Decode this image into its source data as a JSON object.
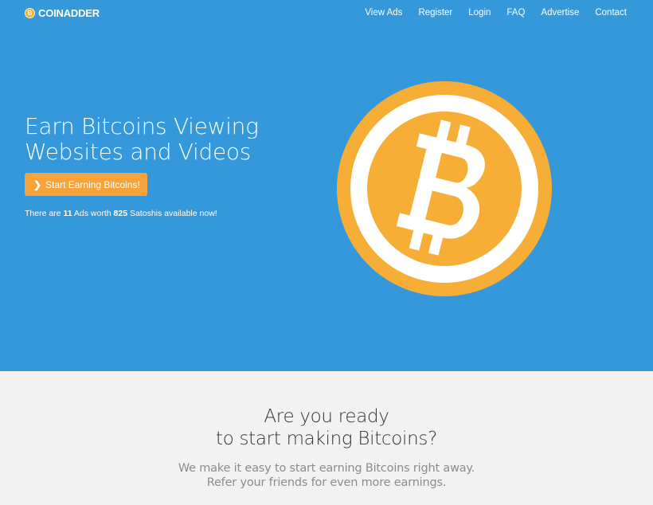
{
  "brand": {
    "coin_glyph": "B",
    "name": "COINADDER"
  },
  "nav": {
    "items": [
      {
        "label": "View Ads"
      },
      {
        "label": "Register"
      },
      {
        "label": "Login"
      },
      {
        "label": "FAQ"
      },
      {
        "label": "Advertise"
      },
      {
        "label": "Contact"
      }
    ]
  },
  "hero": {
    "headline_line1": "Earn Bitcoins Viewing",
    "headline_line2": "Websites and Videos",
    "cta_label": "Start Earning Bitcoins!",
    "cta_icon": "chevron-right-icon",
    "available_prefix": "There are",
    "ad_count": "11",
    "ads_worth": "Ads worth",
    "satoshi_amount": "825",
    "available_suffix": "Satoshis available now!"
  },
  "bitcoin_logo": {
    "icon": "bitcoin-icon"
  },
  "section": {
    "heading_line1": "Are you ready",
    "heading_line2": "to start making Bitcoins?",
    "sub_line1": "We make it easy to start earning Bitcoins right away.",
    "sub_line2": "Refer your friends for even more earnings."
  },
  "colors": {
    "hero_bg": "#3498db",
    "accent_orange": "#f5a33a",
    "coin_orange": "#f7ae36",
    "section_bg": "#f2f2f2"
  }
}
